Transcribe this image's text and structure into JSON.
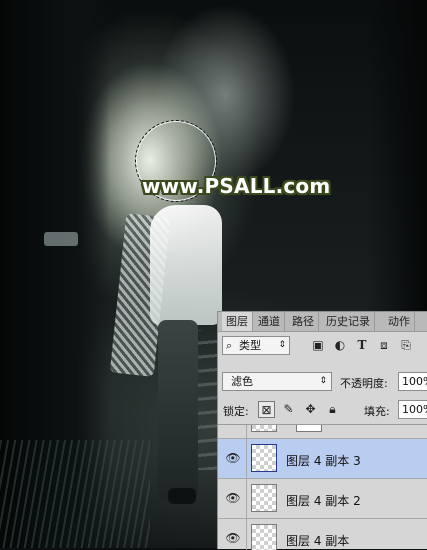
{
  "watermark": "www.PSALL.com",
  "layers_panel": {
    "tabs": [
      {
        "label": "图层",
        "active": true
      },
      {
        "label": "通道",
        "active": false
      },
      {
        "label": "路径",
        "active": false
      },
      {
        "label": "历史记录",
        "active": false
      },
      {
        "label": "动作",
        "active": false
      }
    ],
    "filter": {
      "kind_label": "类型",
      "icons": [
        "image-filter-icon",
        "adjustment-filter-icon",
        "type-filter-icon",
        "shape-filter-icon",
        "smart-object-filter-icon"
      ]
    },
    "blend_mode": "滤色",
    "opacity_label": "不透明度:",
    "opacity_value": "100%",
    "lock_label": "锁定:",
    "lock_icons": [
      "lock-transparent-pixels-icon",
      "lock-image-pixels-icon",
      "lock-position-icon",
      "lock-all-icon"
    ],
    "fill_label": "填充:",
    "fill_value": "100%",
    "layers": [
      {
        "name": "",
        "visible": false,
        "selected": false,
        "partial": true
      },
      {
        "name": "图层 4 副本 3",
        "visible": true,
        "selected": true
      },
      {
        "name": "图层 4 副本 2",
        "visible": true,
        "selected": false
      },
      {
        "name": "图层 4 副本",
        "visible": true,
        "selected": false
      }
    ]
  },
  "colors": {
    "panel_bg": "#d6d6d6",
    "tab_bar_bg": "#b9b9b9",
    "selected_layer_bg": "#b9cdf0",
    "watermark_fill": "#ffffff",
    "watermark_outline": "#3a4a1e"
  }
}
